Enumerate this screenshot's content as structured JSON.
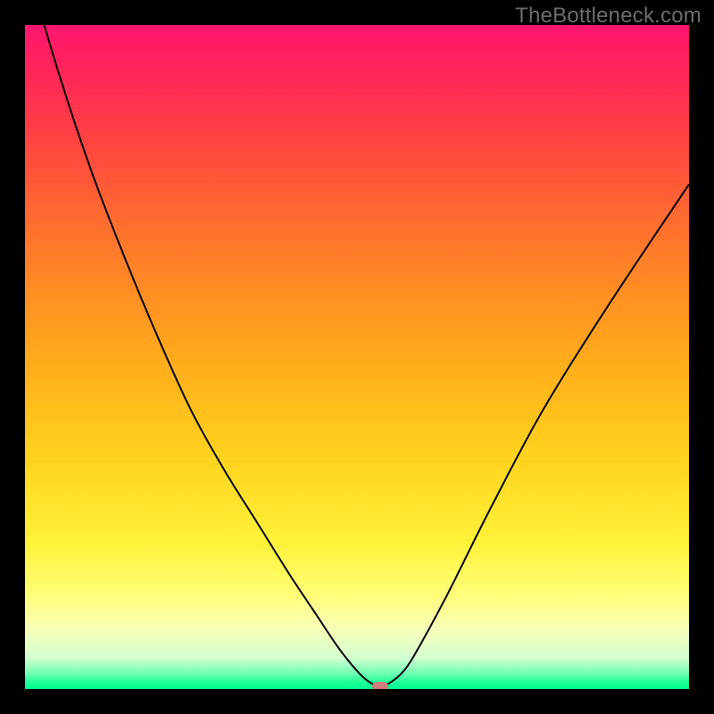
{
  "watermark": "TheBottleneck.com",
  "colors": {
    "frame": "#000000",
    "curve": "#000000",
    "marker": "#cf7c7c"
  },
  "gradient_stops": [
    {
      "offset": 0.0,
      "color": "#ff1670"
    },
    {
      "offset": 0.07,
      "color": "#ff2559"
    },
    {
      "offset": 0.18,
      "color": "#ff4540"
    },
    {
      "offset": 0.33,
      "color": "#ff782b"
    },
    {
      "offset": 0.5,
      "color": "#ffaa1b"
    },
    {
      "offset": 0.65,
      "color": "#ffd21e"
    },
    {
      "offset": 0.78,
      "color": "#fff23a"
    },
    {
      "offset": 0.86,
      "color": "#ffff7a"
    },
    {
      "offset": 0.91,
      "color": "#f8ffb9"
    },
    {
      "offset": 0.953,
      "color": "#d3ffd0"
    },
    {
      "offset": 0.975,
      "color": "#77ffb5"
    },
    {
      "offset": 0.99,
      "color": "#1fff97"
    },
    {
      "offset": 1.0,
      "color": "#00ff8f"
    }
  ],
  "chart_data": {
    "type": "line",
    "title": "",
    "xlabel": "",
    "ylabel": "",
    "x_range": [
      0,
      100
    ],
    "y_range": [
      0,
      100
    ],
    "optimal_x": 53.5,
    "marker": {
      "x": 53.5,
      "y": 0.4,
      "w_pct": 2.3,
      "h_pct": 1.3
    },
    "series": [
      {
        "name": "bottleneck",
        "x": [
          0,
          5,
          10,
          15,
          20,
          25,
          30,
          35,
          40,
          44,
          47,
          49.5,
          51.5,
          53.5,
          55.5,
          57.5,
          60,
          64,
          70,
          78,
          88,
          100
        ],
        "y": [
          110,
          93,
          78,
          65,
          53,
          42,
          33,
          25,
          17,
          11,
          6.5,
          3.3,
          1.3,
          0.4,
          1.3,
          3.3,
          7.5,
          15,
          27,
          42,
          58,
          76
        ]
      }
    ]
  }
}
